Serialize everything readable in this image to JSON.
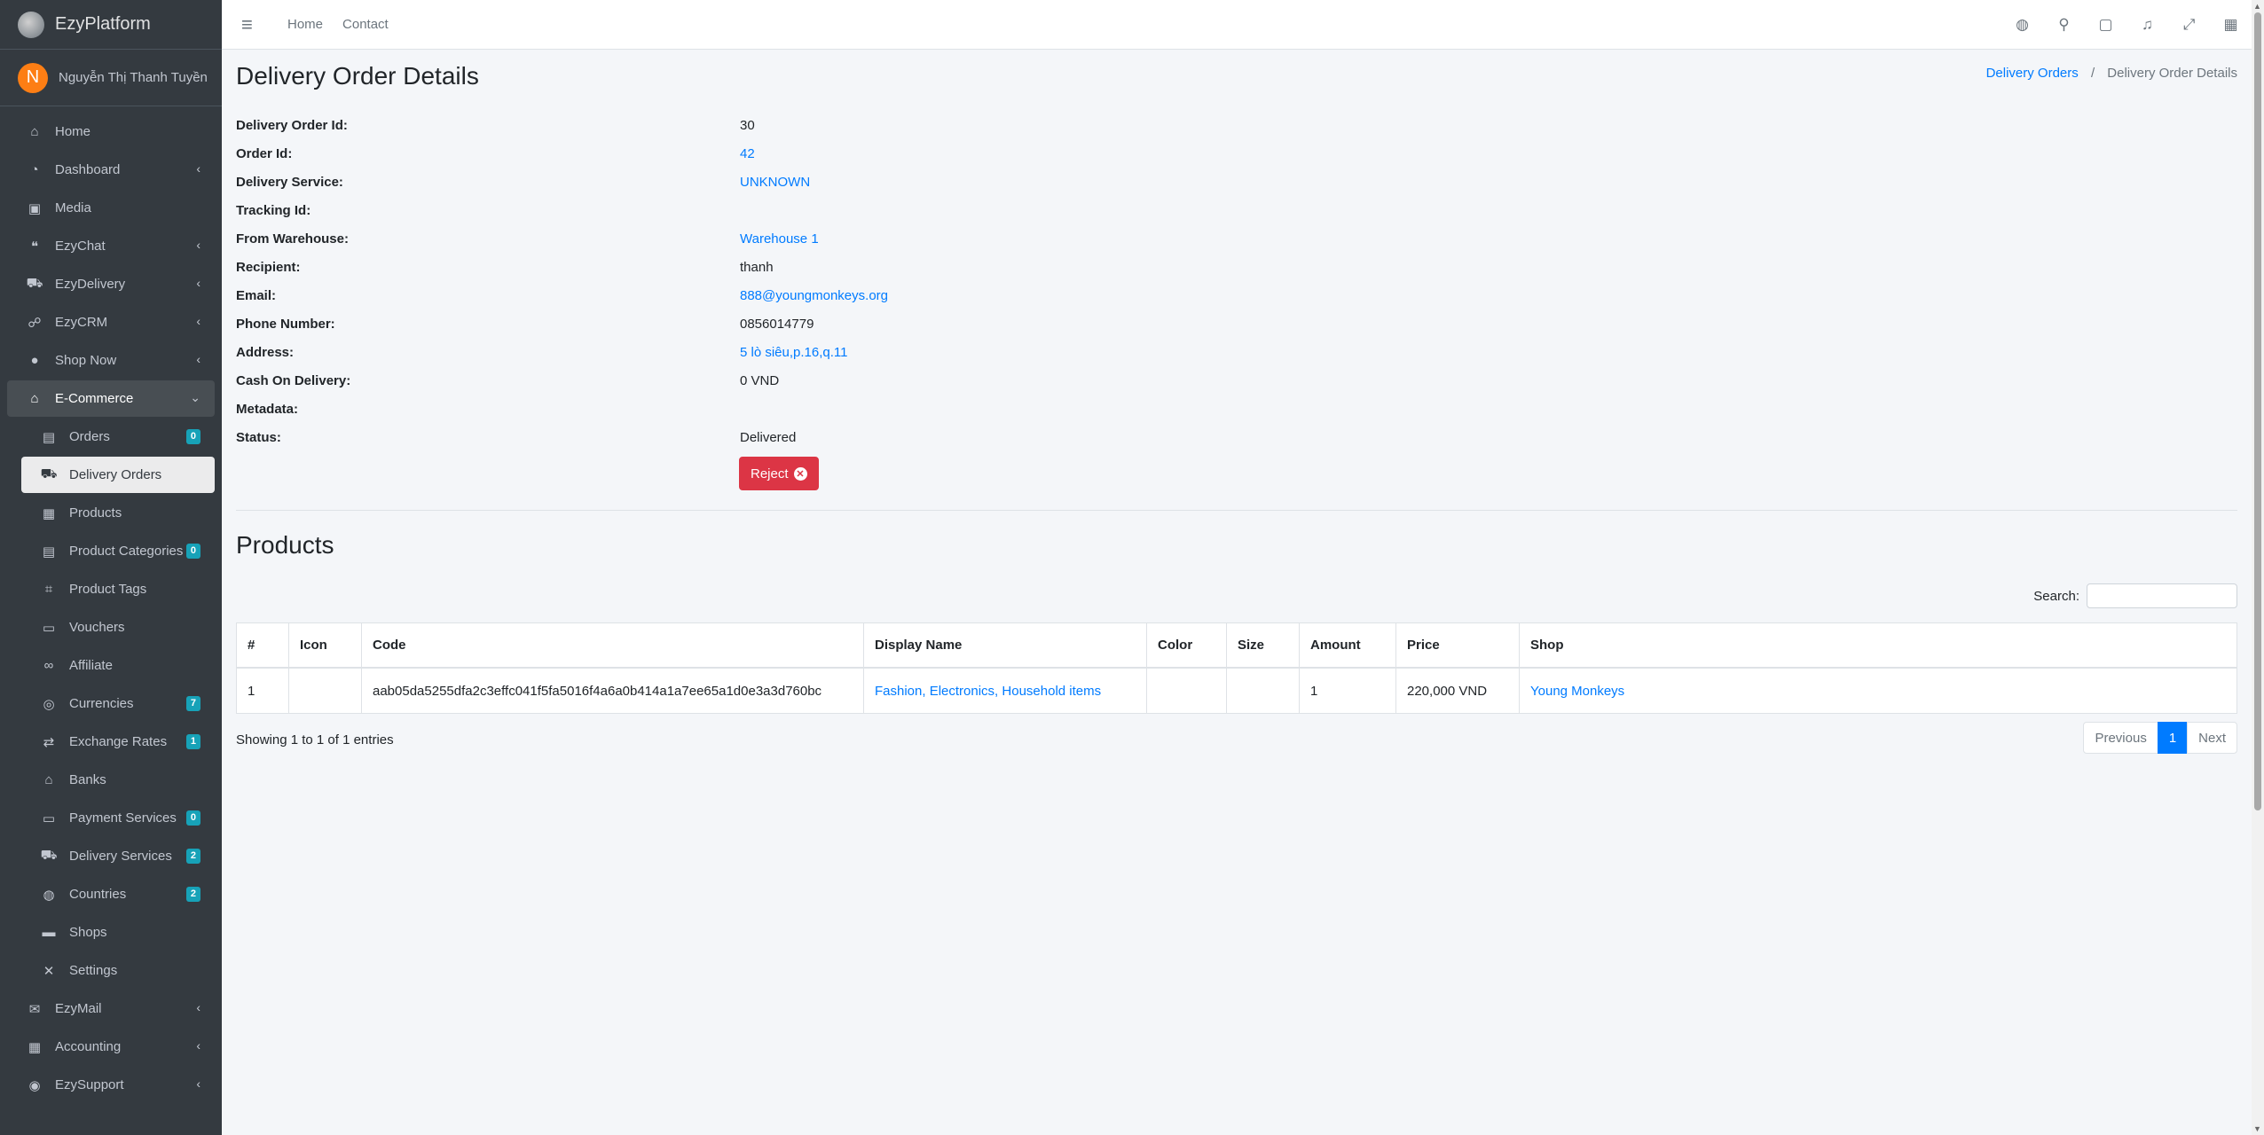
{
  "brand": {
    "name": "EzyPlatform"
  },
  "user": {
    "initial": "N",
    "name": "Nguyễn Thị Thanh Tuyền"
  },
  "sidebar": {
    "items": [
      {
        "label": "Home",
        "icon": "home-icon",
        "glyph": "⌂"
      },
      {
        "label": "Dashboard",
        "icon": "tachometer-icon",
        "glyph": "◔",
        "arrow": "‹"
      },
      {
        "label": "Media",
        "icon": "photo-icon",
        "glyph": "▣"
      },
      {
        "label": "EzyChat",
        "icon": "comments-icon",
        "glyph": "❝",
        "arrow": "‹"
      },
      {
        "label": "EzyDelivery",
        "icon": "truck-icon",
        "glyph": "⛟",
        "arrow": "‹"
      },
      {
        "label": "EzyCRM",
        "icon": "handshake-icon",
        "glyph": "☍",
        "arrow": "‹"
      },
      {
        "label": "Shop Now",
        "icon": "circle-icon",
        "glyph": "●",
        "arrow": "‹"
      },
      {
        "label": "E-Commerce",
        "icon": "basket-icon",
        "glyph": "⌂",
        "arrow": "⌄"
      }
    ],
    "sub_items": [
      {
        "label": "Orders",
        "icon": "file-icon",
        "glyph": "▤",
        "badge": "0"
      },
      {
        "label": "Delivery Orders",
        "icon": "delivery-icon",
        "glyph": "⛟"
      },
      {
        "label": "Products",
        "icon": "boxes-icon",
        "glyph": "▦"
      },
      {
        "label": "Product Categories",
        "icon": "file-icon",
        "glyph": "▤",
        "badge": "0"
      },
      {
        "label": "Product Tags",
        "icon": "tags-icon",
        "glyph": "⌗"
      },
      {
        "label": "Vouchers",
        "icon": "ticket-icon",
        "glyph": "▭"
      },
      {
        "label": "Affiliate",
        "icon": "link-icon",
        "glyph": "∞"
      },
      {
        "label": "Currencies",
        "icon": "coins-icon",
        "glyph": "◎",
        "badge": "7"
      },
      {
        "label": "Exchange Rates",
        "icon": "exchange-icon",
        "glyph": "⇄",
        "badge": "1"
      },
      {
        "label": "Banks",
        "icon": "bank-icon",
        "glyph": "⌂"
      },
      {
        "label": "Payment Services",
        "icon": "credit-card-icon",
        "glyph": "▭",
        "badge": "0"
      },
      {
        "label": "Delivery Services",
        "icon": "truck-icon",
        "glyph": "⛟",
        "badge": "2"
      },
      {
        "label": "Countries",
        "icon": "globe-icon",
        "glyph": "◍",
        "badge": "2"
      },
      {
        "label": "Shops",
        "icon": "store-icon",
        "glyph": "▬"
      },
      {
        "label": "Settings",
        "icon": "tools-icon",
        "glyph": "✕"
      }
    ],
    "bottom_items": [
      {
        "label": "EzyMail",
        "icon": "envelope-icon",
        "glyph": "✉",
        "arrow": "‹"
      },
      {
        "label": "Accounting",
        "icon": "calculator-icon",
        "glyph": "▦",
        "arrow": "‹"
      },
      {
        "label": "EzySupport",
        "icon": "life-ring-icon",
        "glyph": "◉",
        "arrow": "‹"
      }
    ]
  },
  "topbar": {
    "menu_glyph": "≡",
    "links": [
      "Home",
      "Contact"
    ],
    "icons": [
      {
        "name": "language-icon",
        "glyph": "◍"
      },
      {
        "name": "search-icon",
        "glyph": "⚲"
      },
      {
        "name": "messages-icon",
        "glyph": "▢"
      },
      {
        "name": "notifications-icon",
        "glyph": "♫"
      },
      {
        "name": "fullscreen-icon",
        "glyph": "⤢"
      },
      {
        "name": "apps-icon",
        "glyph": "▦"
      }
    ]
  },
  "page": {
    "title": "Delivery Order Details",
    "breadcrumb": {
      "parent": "Delivery Orders",
      "separator": "/",
      "current": "Delivery Order Details"
    }
  },
  "details": [
    {
      "label": "Delivery Order Id:",
      "value": "30",
      "link": false
    },
    {
      "label": "Order Id:",
      "value": "42",
      "link": true
    },
    {
      "label": "Delivery Service:",
      "value": "UNKNOWN",
      "link": true
    },
    {
      "label": "Tracking Id:",
      "value": "",
      "link": false
    },
    {
      "label": "From Warehouse:",
      "value": "Warehouse 1",
      "link": true
    },
    {
      "label": "Recipient:",
      "value": "thanh",
      "link": false
    },
    {
      "label": "Email:",
      "value": "888@youngmonkeys.org",
      "link": true
    },
    {
      "label": "Phone Number:",
      "value": "0856014779",
      "link": false
    },
    {
      "label": "Address:",
      "value": "5 lò siêu,p.16,q.11",
      "link": true
    },
    {
      "label": "Cash On Delivery:",
      "value": "0 VND",
      "link": false
    },
    {
      "label": "Metadata:",
      "value": "",
      "link": false
    },
    {
      "label": "Status:",
      "value": "Delivered",
      "link": false
    }
  ],
  "actions": {
    "reject_label": "Reject",
    "reject_glyph": "✕"
  },
  "products": {
    "title": "Products",
    "search_label": "Search:",
    "search_value": "",
    "columns": [
      "#",
      "Icon",
      "Code",
      "Display Name",
      "Color",
      "Size",
      "Amount",
      "Price",
      "Shop"
    ],
    "rows": [
      {
        "num": "1",
        "icon": "",
        "code": "aab05da5255dfa2c3effc041f5fa5016f4a6a0b414a1a7ee65a1d0e3a3d760bc",
        "display_name": "Fashion, Electronics, Household items",
        "color": "",
        "size": "",
        "amount": "1",
        "price": "220,000 VND",
        "shop": "Young Monkeys"
      }
    ],
    "showing": "Showing 1 to 1 of 1 entries",
    "pagination": {
      "previous": "Previous",
      "current": "1",
      "next": "Next"
    }
  },
  "colors": {
    "sidebar_bg": "#343a40",
    "link": "#007bff",
    "danger": "#dc3545",
    "badge": "#17a2b8",
    "avatar": "#fd7e14"
  }
}
